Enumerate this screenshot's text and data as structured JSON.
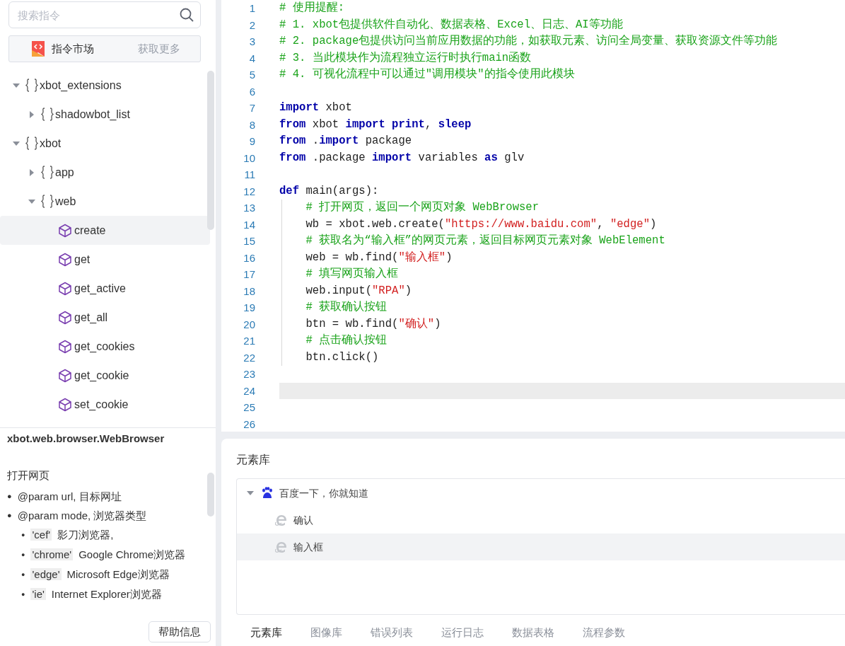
{
  "sidebar": {
    "search": {
      "placeholder": "搜索指令"
    },
    "market": {
      "label": "指令市场",
      "link": "获取更多"
    },
    "tree": [
      {
        "label": "xbot_extensions",
        "kind": "module",
        "expanded": true,
        "selected": false,
        "children": [
          {
            "label": "shadowbot_list",
            "kind": "module",
            "expanded": false,
            "selected": false
          }
        ]
      },
      {
        "label": "xbot",
        "kind": "module",
        "expanded": true,
        "selected": false,
        "children": [
          {
            "label": "app",
            "kind": "module",
            "expanded": false,
            "selected": false
          },
          {
            "label": "web",
            "kind": "module",
            "expanded": true,
            "selected": false,
            "children": [
              {
                "label": "create",
                "kind": "function",
                "selected": true
              },
              {
                "label": "get",
                "kind": "function",
                "selected": false
              },
              {
                "label": "get_active",
                "kind": "function",
                "selected": false
              },
              {
                "label": "get_all",
                "kind": "function",
                "selected": false
              },
              {
                "label": "get_cookies",
                "kind": "function",
                "selected": false
              },
              {
                "label": "get_cookie",
                "kind": "function",
                "selected": false
              },
              {
                "label": "set_cookie",
                "kind": "function",
                "selected": false
              }
            ]
          }
        ]
      }
    ],
    "doc": {
      "title": "xbot.web.browser.WebBrowser",
      "summary": "打开网页",
      "params": [
        {
          "bullet": "●",
          "text": "@param url, 目标网址"
        },
        {
          "bullet": "●",
          "text": "@param mode, 浏览器类型",
          "children": [
            {
              "bullet": "●",
              "code": "'cef'",
              "text": "影刀浏览器,"
            },
            {
              "bullet": "●",
              "code": "'chrome'",
              "text": "Google Chrome浏览器"
            },
            {
              "bullet": "●",
              "code": "'edge'",
              "text": "Microsoft Edge浏览器"
            },
            {
              "bullet": "●",
              "code": "'ie'",
              "text": "Internet Explorer浏览器"
            }
          ]
        }
      ]
    },
    "help_button": "帮助信息"
  },
  "editor": {
    "lines": [
      {
        "number": "1",
        "current": false,
        "tokens": [
          {
            "kind": "comment",
            "text": "# 使用提醒:"
          }
        ]
      },
      {
        "number": "2",
        "current": false,
        "tokens": [
          {
            "kind": "comment",
            "text": "# 1. xbot包提供软件自动化、数据表格、Excel、日志、AI等功能"
          }
        ]
      },
      {
        "number": "3",
        "current": false,
        "tokens": [
          {
            "kind": "comment",
            "text": "# 2. package包提供访问当前应用数据的功能，如获取元素、访问全局变量、获取资源文件等功能"
          }
        ]
      },
      {
        "number": "4",
        "current": false,
        "tokens": [
          {
            "kind": "comment",
            "text": "# 3. 当此模块作为流程独立运行时执行main函数"
          }
        ]
      },
      {
        "number": "5",
        "current": false,
        "tokens": [
          {
            "kind": "comment",
            "text": "# 4. 可视化流程中可以通过\"调用模块\"的指令使用此模块"
          }
        ]
      },
      {
        "number": "6",
        "current": false
      },
      {
        "number": "7",
        "current": false,
        "tokens": [
          {
            "kind": "keyword",
            "text": "import"
          },
          {
            "kind": "plain",
            "text": " xbot"
          }
        ]
      },
      {
        "number": "8",
        "current": false,
        "tokens": [
          {
            "kind": "keyword",
            "text": "from"
          },
          {
            "kind": "plain",
            "text": " xbot "
          },
          {
            "kind": "keyword",
            "text": "import"
          },
          {
            "kind": "keyword",
            "text": " print"
          },
          {
            "kind": "plain",
            "text": ", "
          },
          {
            "kind": "keyword",
            "text": "sleep"
          }
        ]
      },
      {
        "number": "9",
        "current": false,
        "tokens": [
          {
            "kind": "keyword",
            "text": "from"
          },
          {
            "kind": "plain",
            "text": " ."
          },
          {
            "kind": "keyword",
            "text": "import"
          },
          {
            "kind": "plain",
            "text": " package"
          }
        ]
      },
      {
        "number": "10",
        "current": false,
        "tokens": [
          {
            "kind": "keyword",
            "text": "from"
          },
          {
            "kind": "plain",
            "text": " .package "
          },
          {
            "kind": "keyword",
            "text": "import"
          },
          {
            "kind": "plain",
            "text": " variables "
          },
          {
            "kind": "keyword",
            "text": "as"
          },
          {
            "kind": "plain",
            "text": " glv"
          }
        ]
      },
      {
        "number": "11",
        "current": false
      },
      {
        "number": "12",
        "current": false,
        "tokens": [
          {
            "kind": "keyword",
            "text": "def"
          },
          {
            "kind": "plain",
            "text": " main(args):"
          }
        ]
      },
      {
        "number": "13",
        "current": false,
        "tokens": [
          {
            "kind": "comment",
            "text": "    # 打开网页，返回一个网页对象 WebBrowser"
          }
        ]
      },
      {
        "number": "14",
        "current": false,
        "tokens": [
          {
            "kind": "plain",
            "text": "    wb = xbot.web.create("
          },
          {
            "kind": "string",
            "text": "\"https://www.baidu.com\""
          },
          {
            "kind": "plain",
            "text": ", "
          },
          {
            "kind": "string",
            "text": "\"edge\""
          },
          {
            "kind": "plain",
            "text": ")"
          }
        ]
      },
      {
        "number": "15",
        "current": false,
        "tokens": [
          {
            "kind": "comment",
            "text": "    # 获取名为“输入框”的网页元素，返回目标网页元素对象 WebElement"
          }
        ]
      },
      {
        "number": "16",
        "current": false,
        "tokens": [
          {
            "kind": "plain",
            "text": "    web = wb.find("
          },
          {
            "kind": "string",
            "text": "\"输入框\""
          },
          {
            "kind": "plain",
            "text": ")"
          }
        ]
      },
      {
        "number": "17",
        "current": false,
        "tokens": [
          {
            "kind": "comment",
            "text": "    # 填写网页输入框"
          }
        ]
      },
      {
        "number": "18",
        "current": false,
        "tokens": [
          {
            "kind": "plain",
            "text": "    web.input("
          },
          {
            "kind": "string",
            "text": "\"RPA\""
          },
          {
            "kind": "plain",
            "text": ")"
          }
        ]
      },
      {
        "number": "19",
        "current": false,
        "tokens": [
          {
            "kind": "comment",
            "text": "    # 获取确认按钮"
          }
        ]
      },
      {
        "number": "20",
        "current": false,
        "tokens": [
          {
            "kind": "plain",
            "text": "    btn = wb.find("
          },
          {
            "kind": "string",
            "text": "\"确认\""
          },
          {
            "kind": "plain",
            "text": ")"
          }
        ]
      },
      {
        "number": "21",
        "current": false,
        "tokens": [
          {
            "kind": "comment",
            "text": "    # 点击确认按钮"
          }
        ]
      },
      {
        "number": "22",
        "current": false,
        "tokens": [
          {
            "kind": "plain",
            "text": "    btn.click()"
          }
        ]
      },
      {
        "number": "23",
        "current": false
      },
      {
        "number": "24",
        "current": true
      },
      {
        "number": "25",
        "current": false
      },
      {
        "number": "26",
        "current": false
      }
    ]
  },
  "element_library": {
    "title": "元素库",
    "groups": [
      {
        "label": "百度一下，你就知道",
        "expanded": true,
        "children": [
          {
            "label": "确认",
            "selected": false
          },
          {
            "label": "输入框",
            "selected": true
          }
        ]
      }
    ]
  },
  "bottom_tabs": [
    {
      "label": "元素库",
      "selected": true
    },
    {
      "label": "图像库",
      "selected": false
    },
    {
      "label": "错误列表",
      "selected": false
    },
    {
      "label": "运行日志",
      "selected": false
    },
    {
      "label": "数据表格",
      "selected": false
    },
    {
      "label": "流程参数",
      "selected": false
    }
  ]
}
